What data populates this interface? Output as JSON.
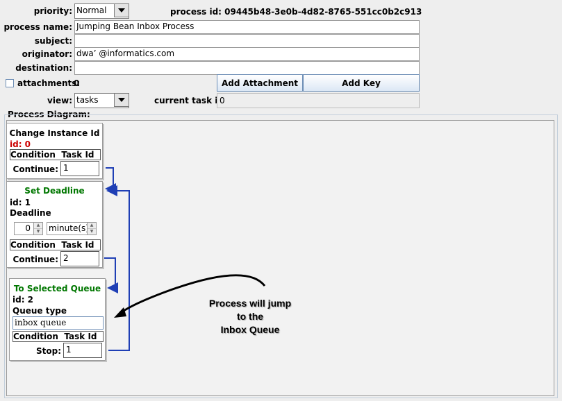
{
  "form": {
    "priority_label": "priority:",
    "priority_value": "Normal",
    "process_id_label": "process id:",
    "process_id_value": "09445b48-3e0b-4d82-8765-551cc0b2c913",
    "process_name_label": "process name:",
    "process_name_value": "Jumping Bean Inbox Process",
    "subject_label": "subject:",
    "subject_value": "",
    "originator_label": "originator:",
    "originator_value": "dwa’ @informatics.com",
    "destination_label": "destination:",
    "destination_value": "",
    "attachments_label": "attachments:",
    "attachments_count": "0",
    "add_attachment": "Add Attachment",
    "add_key": "Add Key",
    "view_label": "view:",
    "view_value": "tasks",
    "current_task_label": "current task id:",
    "current_task_value": "0"
  },
  "diagram": {
    "label": "Process Diagram:",
    "nodes": [
      {
        "title": "Change Instance Id",
        "title_color": "#000000",
        "id_text": "id: 0",
        "id_color": "#cc0000",
        "col_condition": "Condition",
        "col_task": "Task Id",
        "transition_label": "Continue:",
        "transition_value": "1"
      },
      {
        "title": "Set Deadline",
        "title_color": "#007700",
        "id_text": "id: 1",
        "id_color": "#000000",
        "param_label": "Deadline",
        "spin_value": "0",
        "unit_value": "minute(s)",
        "col_condition": "Condition",
        "col_task": "Task Id",
        "transition_label": "Continue:",
        "transition_value": "2"
      },
      {
        "title": "To Selected Queue",
        "title_color": "#007700",
        "id_text": "id: 2",
        "id_color": "#000000",
        "param_label": "Queue type",
        "queue_value": "inbox queue",
        "col_condition": "Condition",
        "col_task": "Task Id",
        "transition_label": "Stop:",
        "transition_value": "1"
      }
    ],
    "annotation_lines": [
      "Process will jump",
      "to the",
      "Inbox Queue"
    ],
    "connector_color": "#1f3fb5"
  }
}
